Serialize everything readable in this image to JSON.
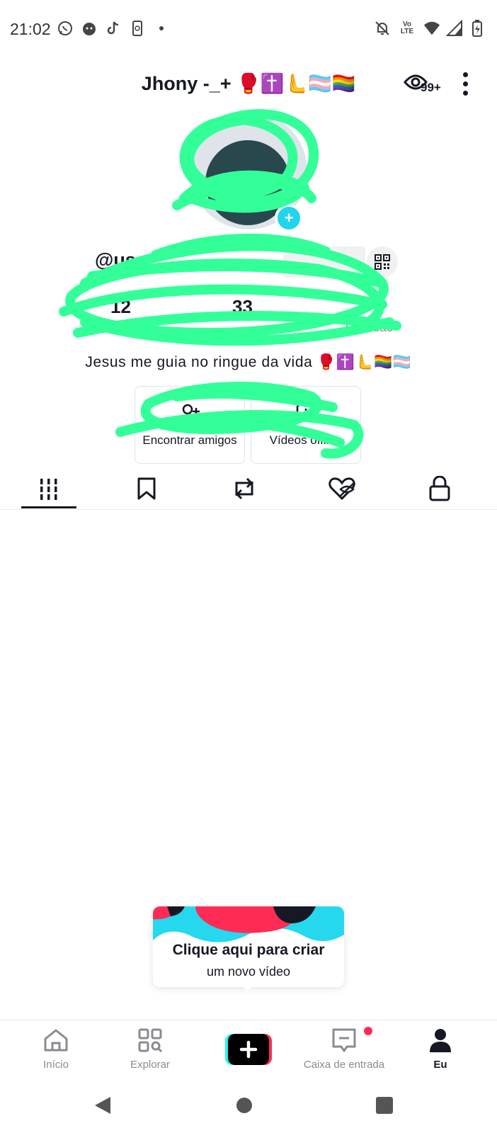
{
  "status_bar": {
    "time": "21:02",
    "left_icons": [
      "whatsapp-icon",
      "face-icon",
      "tiktok-icon",
      "phone-sync-icon",
      "dot-icon"
    ],
    "right_icons": [
      "bell-off-icon",
      "volte-icon",
      "wifi-icon",
      "signal-icon",
      "battery-icon"
    ],
    "volte_text": "Vo LTE"
  },
  "header": {
    "display_name": "Jhony -_+ 🥊✝️🫷🏳️‍⚧️🏳️‍🌈",
    "views_count": "99+"
  },
  "profile": {
    "username": "@use",
    "stats": [
      {
        "value": "12",
        "label": ""
      },
      {
        "value": "33",
        "label": ""
      },
      {
        "value": "",
        "label": "Curtidas"
      }
    ],
    "bio": "Jesus me guia no ringue da vida 🥊✝️🫷🏳️‍🌈🏳️‍⚧️"
  },
  "actions": [
    {
      "label": "Encontrar amigos",
      "icon": "add-friend-icon"
    },
    {
      "label": "Vídeos offline",
      "icon": "offline-video-icon"
    }
  ],
  "tabs": [
    {
      "name": "videos",
      "icon": "grid-icon",
      "active": true
    },
    {
      "name": "saved",
      "icon": "bookmark-icon",
      "active": false
    },
    {
      "name": "reposts",
      "icon": "repost-icon",
      "active": false
    },
    {
      "name": "liked",
      "icon": "hidden-heart-icon",
      "active": false
    },
    {
      "name": "private",
      "icon": "lock-icon",
      "active": false
    }
  ],
  "create_tip": {
    "title": "Clique aqui para criar",
    "subtitle": "um novo vídeo"
  },
  "bottom_nav": {
    "home": "Início",
    "explore": "Explorar",
    "create": "+",
    "inbox": "Caixa de entrada",
    "me": "Eu"
  },
  "colors": {
    "accent_cyan": "#20d5ec",
    "accent_pink": "#fe2c55",
    "scribble": "#33ff99",
    "text": "#161823",
    "muted": "#8a8b91"
  }
}
